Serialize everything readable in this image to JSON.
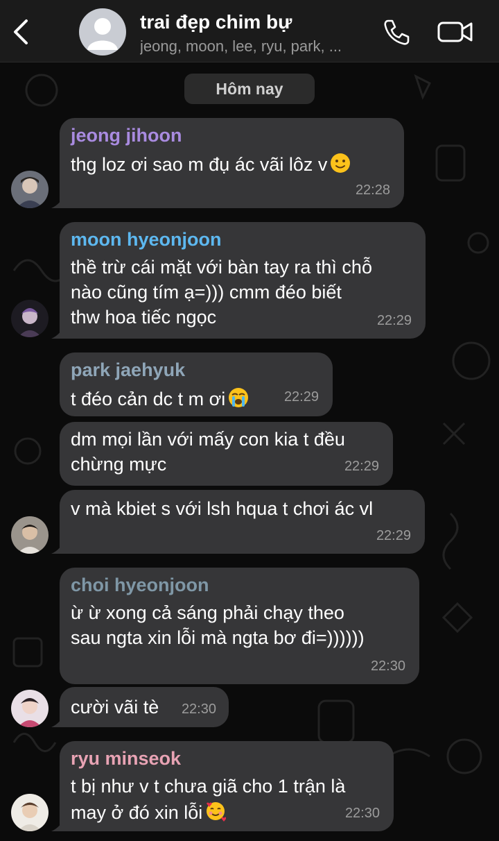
{
  "header": {
    "back_label": "back",
    "group_name": "trai đẹp chim bự",
    "members": "jeong, moon, lee, ryu, park, ...",
    "icons": {
      "back": "chevron-left-icon",
      "call": "phone-icon",
      "video": "video-camera-icon"
    }
  },
  "date_label": "Hôm nay",
  "colors": {
    "jeong": "#a98be0",
    "moon": "#5db8f0",
    "park": "#8fa6b8",
    "choi": "#7f97a6",
    "ryu": "#e8a3b4",
    "bubble": "#363638",
    "header": "#1b1b1b"
  },
  "messages": [
    {
      "sender": "jeong jihoon",
      "lines": [
        "thg loz ơi sao m đụ ác vãi lôz v"
      ],
      "emoji": "slight-smile",
      "time": "22:28"
    },
    {
      "sender": "moon hyeonjoon",
      "lines": [
        "thề trừ cái mặt với bàn tay ra thì chỗ",
        "nào cũng tím ạ=))) cmm đéo biết",
        "thw hoa tiếc ngọc"
      ],
      "time": "22:29"
    },
    {
      "sender": "park jaehyuk",
      "lines": [
        "t đéo cản dc t m ơi"
      ],
      "emoji": "loudly-crying",
      "time": "22:29"
    },
    {
      "sender": "",
      "lines": [
        "dm mọi lần với mấy con kia t đều",
        "chừng mực"
      ],
      "time": "22:29"
    },
    {
      "sender": "",
      "lines": [
        "v mà kbiet s với lsh hqua t chơi ác vl"
      ],
      "time": "22:29"
    },
    {
      "sender": "choi hyeonjoon",
      "lines": [
        "ừ ừ xong cả sáng phải chạy theo",
        "sau ngta xin lỗi mà ngta bơ đi=))))))"
      ],
      "time": "22:30"
    },
    {
      "sender": "",
      "lines": [
        "cười vãi tè"
      ],
      "time": "22:30"
    },
    {
      "sender": "ryu minseok",
      "lines": [
        "t bị như v t chưa giã cho 1 trận là",
        "may ở đó xin lỗi"
      ],
      "emoji": "smiling-hearts",
      "time": "22:30"
    }
  ]
}
